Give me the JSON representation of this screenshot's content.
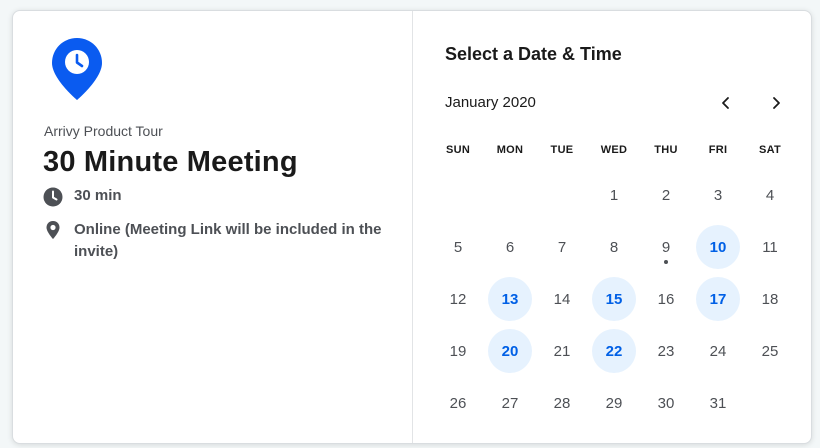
{
  "event": {
    "organizer": "Arrivy Product Tour",
    "title": "30 Minute Meeting",
    "duration": "30 min",
    "location": "Online (Meeting Link will be included in the invite)",
    "logo_icon": "clock-pin-icon",
    "brand_color": "#0a5bf0"
  },
  "scheduler": {
    "heading": "Select a Date & Time",
    "month_label": "January 2020",
    "prev_icon": "chevron-left-icon",
    "next_icon": "chevron-right-icon",
    "weekdays": [
      "SUN",
      "MON",
      "TUE",
      "WED",
      "THU",
      "FRI",
      "SAT"
    ],
    "leading_blank_days": 3,
    "days": [
      {
        "label": "1"
      },
      {
        "label": "2"
      },
      {
        "label": "3"
      },
      {
        "label": "4"
      },
      {
        "label": "5"
      },
      {
        "label": "6"
      },
      {
        "label": "7"
      },
      {
        "label": "8"
      },
      {
        "label": "9",
        "today": true
      },
      {
        "label": "10",
        "available": true
      },
      {
        "label": "11"
      },
      {
        "label": "12"
      },
      {
        "label": "13",
        "available": true
      },
      {
        "label": "14"
      },
      {
        "label": "15",
        "available": true
      },
      {
        "label": "16"
      },
      {
        "label": "17",
        "available": true
      },
      {
        "label": "18"
      },
      {
        "label": "19"
      },
      {
        "label": "20",
        "available": true
      },
      {
        "label": "21"
      },
      {
        "label": "22",
        "available": true
      },
      {
        "label": "23"
      },
      {
        "label": "24"
      },
      {
        "label": "25"
      },
      {
        "label": "26"
      },
      {
        "label": "27"
      },
      {
        "label": "28"
      },
      {
        "label": "29"
      },
      {
        "label": "30"
      },
      {
        "label": "31"
      }
    ],
    "available_bg": "#e6f2fe",
    "available_text": "#0060e6"
  }
}
